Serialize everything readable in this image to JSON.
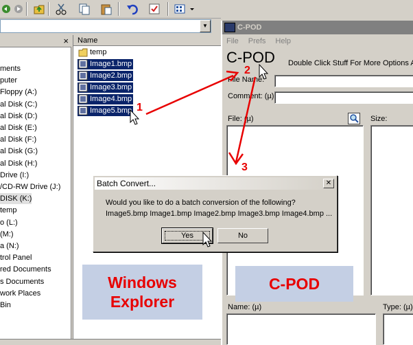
{
  "explorer": {
    "files_header": "Name",
    "tree_items": [
      "ments",
      "puter",
      "Floppy (A:)",
      "al Disk (C:)",
      "al Disk (D:)",
      "al Disk (E:)",
      "al Disk (F:)",
      "al Disk (G:)",
      "al Disk (H:)",
      "Drive (I:)",
      "/CD-RW Drive (J:)",
      "DISK (K:)",
      "temp",
      "o (L:)",
      " (M:)",
      "a (N:)",
      "trol Panel",
      "red Documents",
      "s Documents",
      "work Places",
      "Bin"
    ],
    "files": [
      {
        "name": "temp",
        "type": "folder",
        "selected": false
      },
      {
        "name": "Image1.bmp",
        "type": "bmp",
        "selected": true
      },
      {
        "name": "Image2.bmp",
        "type": "bmp",
        "selected": true
      },
      {
        "name": "Image3.bmp",
        "type": "bmp",
        "selected": true
      },
      {
        "name": "Image4.bmp",
        "type": "bmp",
        "selected": true
      },
      {
        "name": "Image5.bmp",
        "type": "bmp",
        "selected": true
      }
    ],
    "tree_close": "×"
  },
  "cpod": {
    "title": "C-POD",
    "menu": [
      "File",
      "Prefs",
      "Help"
    ],
    "logo": "C-POD",
    "hint": "Double Click Stuff For More Options At",
    "file_name_label": "File Name:",
    "comment_label": "Comment: (µ)",
    "file_list_label": "File: (µ)",
    "size_label": "Size:",
    "name_label": "Name: (µ)",
    "type_label": "Type: (µ)"
  },
  "dialog": {
    "title": "Batch Convert...",
    "close": "✕",
    "message_line1": "Would you like to do a batch conversion of the following?",
    "message_line2": "Image5.bmp Image1.bmp Image2.bmp Image3.bmp Image4.bmp ...",
    "yes_label": "Yes",
    "no_label": "No"
  },
  "labels": {
    "windows_explorer_line1": "Windows",
    "windows_explorer_line2": "Explorer",
    "cpod_label": "C-POD"
  },
  "annotations": {
    "step1": "1",
    "step2": "2",
    "step3": "3"
  },
  "colors": {
    "selection": "#0a246a",
    "annotation_red": "#e80000",
    "label_box": "#c4cfe4"
  }
}
